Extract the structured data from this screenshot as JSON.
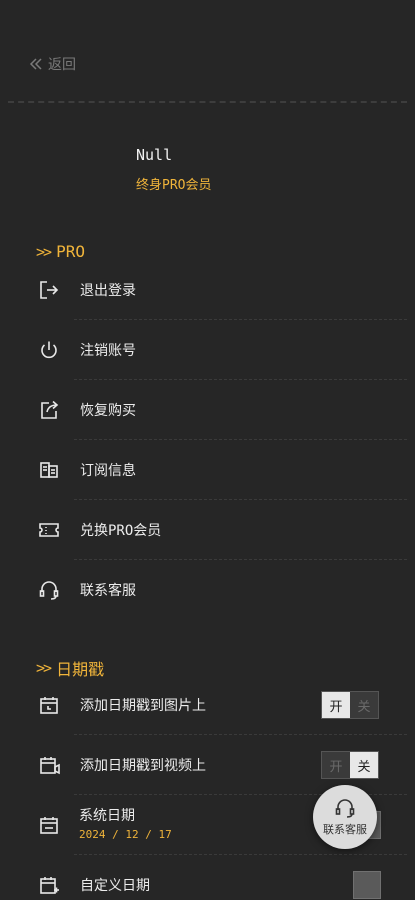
{
  "nav": {
    "back_label": "返回"
  },
  "user": {
    "name": "Null",
    "tier": "终身PRO会员"
  },
  "pro_section": {
    "title": "PRO",
    "items": [
      {
        "label": "退出登录",
        "icon": "logout-icon"
      },
      {
        "label": "注销账号",
        "icon": "power-icon"
      },
      {
        "label": "恢复购买",
        "icon": "restore-icon"
      },
      {
        "label": "订阅信息",
        "icon": "subscription-icon"
      },
      {
        "label": "兑换PRO会员",
        "icon": "ticket-icon"
      },
      {
        "label": "联系客服",
        "icon": "headset-icon"
      }
    ]
  },
  "date_section": {
    "title": "日期戳",
    "photo_stamp": {
      "label": "添加日期戳到图片上",
      "on": "开",
      "off": "关",
      "state": "on"
    },
    "video_stamp": {
      "label": "添加日期戳到视频上",
      "on": "开",
      "off": "关",
      "state": "off"
    },
    "system_date": {
      "label": "系统日期",
      "value": "2024 / 12 / 17"
    },
    "custom_date": {
      "label": "自定义日期"
    }
  },
  "fab": {
    "label": "联系客服"
  },
  "colors": {
    "accent": "#f0b43a",
    "background": "#262626"
  }
}
